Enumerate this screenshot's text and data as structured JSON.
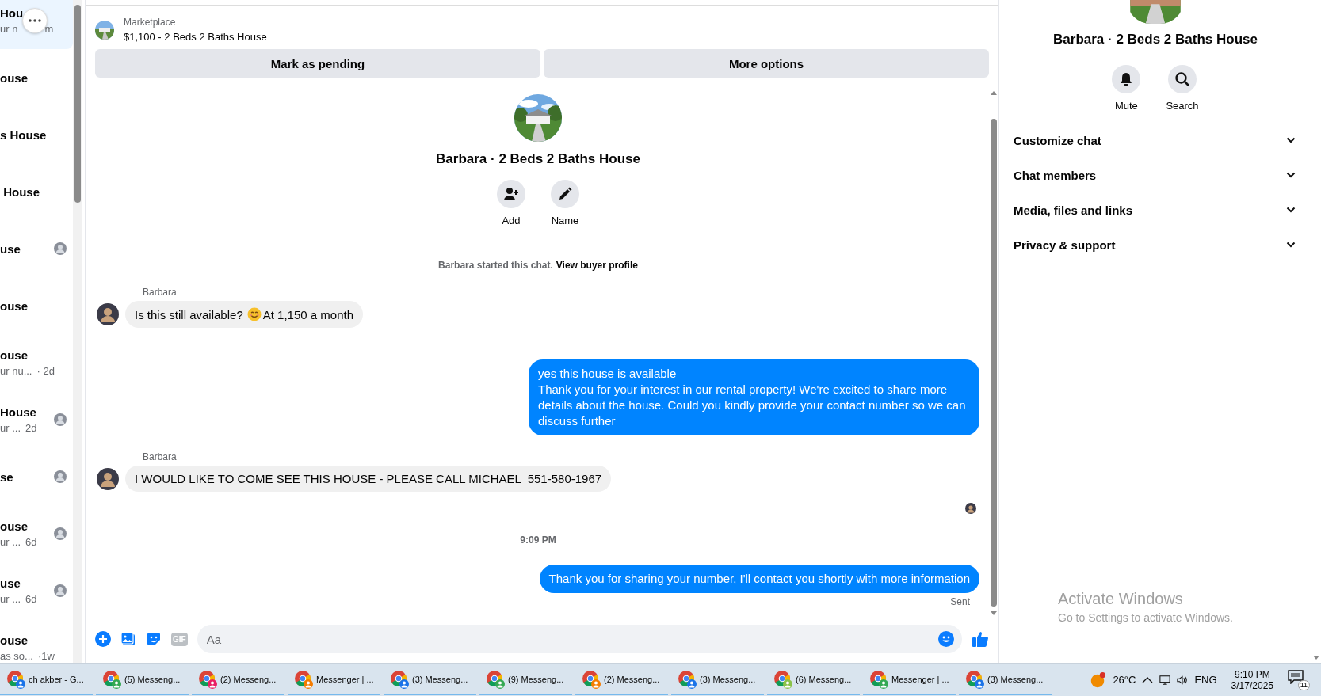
{
  "sidebar": {
    "conversations": [
      {
        "title": "Hou",
        "preview": "ur n",
        "time": "m",
        "selected": true,
        "avatar": false
      },
      {
        "title": "ouse",
        "selected": false,
        "avatar": false
      },
      {
        "title": "s House",
        "selected": false,
        "avatar": false
      },
      {
        "title": " House",
        "selected": false,
        "avatar": false
      },
      {
        "title": "use",
        "selected": false,
        "avatar": true
      },
      {
        "title": "ouse",
        "selected": false,
        "avatar": false
      },
      {
        "title": "ouse",
        "preview": "ur nu...",
        "time": "· 2d",
        "selected": false,
        "avatar": false
      },
      {
        "title": "House",
        "preview": "ur ...",
        "time": "2d",
        "selected": false,
        "avatar": true
      },
      {
        "title": "se",
        "selected": false,
        "avatar": true
      },
      {
        "title": "ouse",
        "preview": "ur ...",
        "time": "6d",
        "selected": false,
        "avatar": true
      },
      {
        "title": "use",
        "preview": "ur ...",
        "time": "6d",
        "selected": false,
        "avatar": true
      },
      {
        "title": "ouse",
        "preview": "as so...",
        "time": "·1w",
        "selected": false,
        "avatar": false
      }
    ]
  },
  "listing": {
    "label": "Marketplace",
    "title": "$1,100 - 2 Beds 2 Baths House",
    "buttons": [
      "Mark as pending",
      "More options"
    ]
  },
  "chat": {
    "title": "Barbara · 2 Beds 2 Baths House",
    "actions": [
      {
        "label": "Add",
        "kind": "add"
      },
      {
        "label": "Name",
        "kind": "name"
      }
    ],
    "notice": {
      "text": "Barbara started this chat.",
      "link": "View buyer profile"
    },
    "messages": [
      {
        "kind": "incoming",
        "sender": "Barbara",
        "lines": [
          "Is this still available?"
        ],
        "emoji": true,
        "after": "At 1,150 a month"
      },
      {
        "kind": "outgoing",
        "lines": [
          "yes this house is available",
          "Thank you for your interest in our rental property! We're excited to share more details about the house. Could you kindly provide your contact number so we can discuss further"
        ]
      },
      {
        "kind": "incoming",
        "sender": "Barbara",
        "lines": [
          "I WOULD LIKE TO COME SEE THIS HOUSE - PLEASE CALL MICHAEL  551-580-1967"
        ],
        "emoji": false
      },
      {
        "kind": "seen"
      },
      {
        "kind": "time",
        "text": "9:09 PM"
      },
      {
        "kind": "outgoing",
        "lines": [
          "Thank you for sharing your number, I'll contact you shortly with more information"
        ],
        "status": "Sent"
      }
    ],
    "composer": {
      "gif": "GIF",
      "placeholder": "Aa"
    }
  },
  "details": {
    "title": "Barbara · 2 Beds 2 Baths House",
    "actions": [
      {
        "label": "Mute",
        "kind": "mute"
      },
      {
        "label": "Search",
        "kind": "search"
      }
    ],
    "sections": [
      {
        "label": "Customize chat",
        "expanded": false
      },
      {
        "label": "Chat members",
        "expanded": false
      },
      {
        "label": "Media, files and links",
        "expanded": false
      },
      {
        "label": "Privacy & support",
        "expanded": false
      }
    ]
  },
  "activation": {
    "title": "Activate Windows",
    "text": "Go to Settings to activate Windows."
  },
  "taskbar": {
    "items": [
      {
        "label": "ch akber - G...",
        "color": "#1a73e8"
      },
      {
        "label": "(5) Messeng...",
        "color": "#34a853"
      },
      {
        "label": "(2) Messeng...",
        "color": "#e91e63"
      },
      {
        "label": "Messenger | ...",
        "color": "#f57c00"
      },
      {
        "label": "(3) Messeng...",
        "color": "#1a73e8"
      },
      {
        "label": "(9) Messeng...",
        "color": "#34a853"
      },
      {
        "label": "(2) Messeng...",
        "color": "#f57c00"
      },
      {
        "label": "(3) Messeng...",
        "color": "#1a73e8"
      },
      {
        "label": "(6) Messeng...",
        "color": "#8bc34a"
      },
      {
        "label": "Messenger | ...",
        "color": "#34a853"
      },
      {
        "label": "(3) Messeng...",
        "color": "#1a73e8"
      }
    ],
    "weather": "26°C",
    "language": "ENG",
    "time": "9:10 PM",
    "date": "3/17/2025",
    "notifications": "11"
  }
}
